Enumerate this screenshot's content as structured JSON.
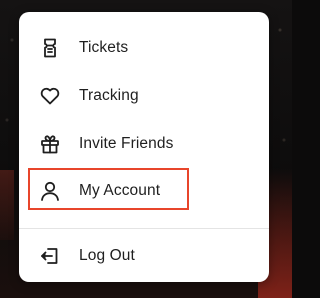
{
  "menu": {
    "items": [
      {
        "label": "Tickets",
        "icon": "ticket-icon"
      },
      {
        "label": "Tracking",
        "icon": "heart-icon"
      },
      {
        "label": "Invite Friends",
        "icon": "gift-icon"
      },
      {
        "label": "My Account",
        "icon": "user-icon",
        "highlighted": true
      }
    ],
    "logout": {
      "label": "Log Out",
      "icon": "logout-icon"
    }
  },
  "colors": {
    "highlight_border": "#e8452b",
    "menu_background": "#ffffff",
    "text": "#1f1f1f"
  }
}
